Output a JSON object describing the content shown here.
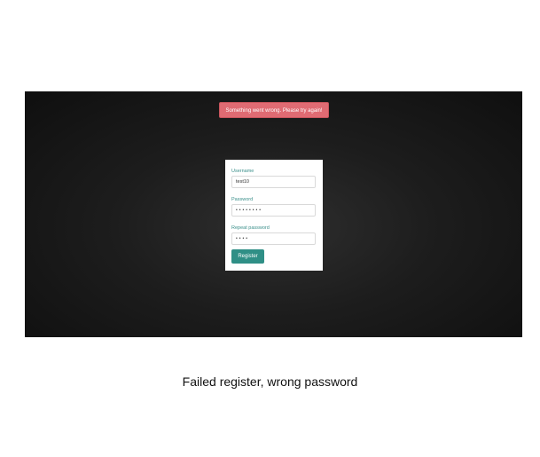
{
  "alert": {
    "message": "Something went wrong. Please try again!"
  },
  "form": {
    "username_label": "Username",
    "username_value": "test10",
    "password_label": "Password",
    "password_mask": "••••••••",
    "repeat_label": "Repeat password",
    "repeat_mask": "••••",
    "submit_label": "Register"
  },
  "caption": "Failed register, wrong password",
  "colors": {
    "alert_bg": "#e06b73",
    "label": "#3a8f8a",
    "button_bg": "#2f8f86",
    "backdrop": "#1d1d1d"
  }
}
